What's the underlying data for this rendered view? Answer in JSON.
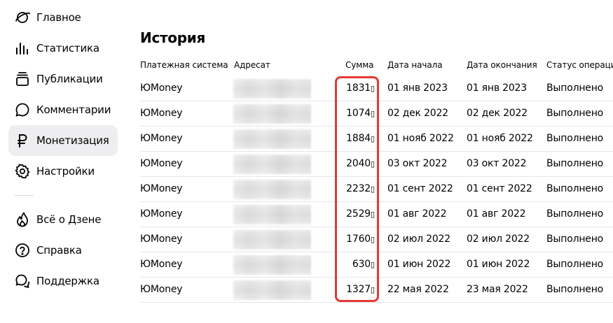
{
  "sidebar": {
    "items": [
      {
        "label": "Главное",
        "icon": "planet-icon"
      },
      {
        "label": "Статистика",
        "icon": "bar-chart-icon"
      },
      {
        "label": "Публикации",
        "icon": "stack-icon"
      },
      {
        "label": "Комментарии",
        "icon": "comment-icon"
      },
      {
        "label": "Монетизация",
        "icon": "ruble-icon",
        "active": true
      },
      {
        "label": "Настройки",
        "icon": "gear-icon"
      }
    ],
    "bottom_items": [
      {
        "label": "Всё о Дзене",
        "icon": "flame-icon"
      },
      {
        "label": "Справка",
        "icon": "help-icon"
      },
      {
        "label": "Поддержка",
        "icon": "chat-bubbles-icon"
      }
    ]
  },
  "main": {
    "title": "История",
    "columns": [
      "Платежная система",
      "Адресат",
      "Сумма",
      "Дата начала",
      "Дата окончания",
      "Статус операции"
    ],
    "rows": [
      {
        "system": "ЮMoney",
        "amount": "1831",
        "start": "01 янв 2023",
        "end": "01 янв 2023",
        "status": "Выполнено"
      },
      {
        "system": "ЮMoney",
        "amount": "1074",
        "start": "02 дек 2022",
        "end": "02 дек 2022",
        "status": "Выполнено"
      },
      {
        "system": "ЮMoney",
        "amount": "1884",
        "start": "01 нояб 2022",
        "end": "01 нояб 2022",
        "status": "Выполнено"
      },
      {
        "system": "ЮMoney",
        "amount": "2040",
        "start": "03 окт 2022",
        "end": "03 окт 2022",
        "status": "Выполнено"
      },
      {
        "system": "ЮMoney",
        "amount": "2232",
        "start": "01 сент 2022",
        "end": "01 сент 2022",
        "status": "Выполнено"
      },
      {
        "system": "ЮMoney",
        "amount": "2529",
        "start": "01 авг 2022",
        "end": "01 авг 2022",
        "status": "Выполнено"
      },
      {
        "system": "ЮMoney",
        "amount": "1760",
        "start": "02 июл 2022",
        "end": "02 июл 2022",
        "status": "Выполнено"
      },
      {
        "system": "ЮMoney",
        "amount": "630",
        "start": "01 июн 2022",
        "end": "01 июн 2022",
        "status": "Выполнено"
      },
      {
        "system": "ЮMoney",
        "amount": "1327",
        "start": "22 мая 2022",
        "end": "23 мая 2022",
        "status": "Выполнено"
      }
    ],
    "currency_glyph": "▯",
    "highlight_color": "#e53935"
  }
}
